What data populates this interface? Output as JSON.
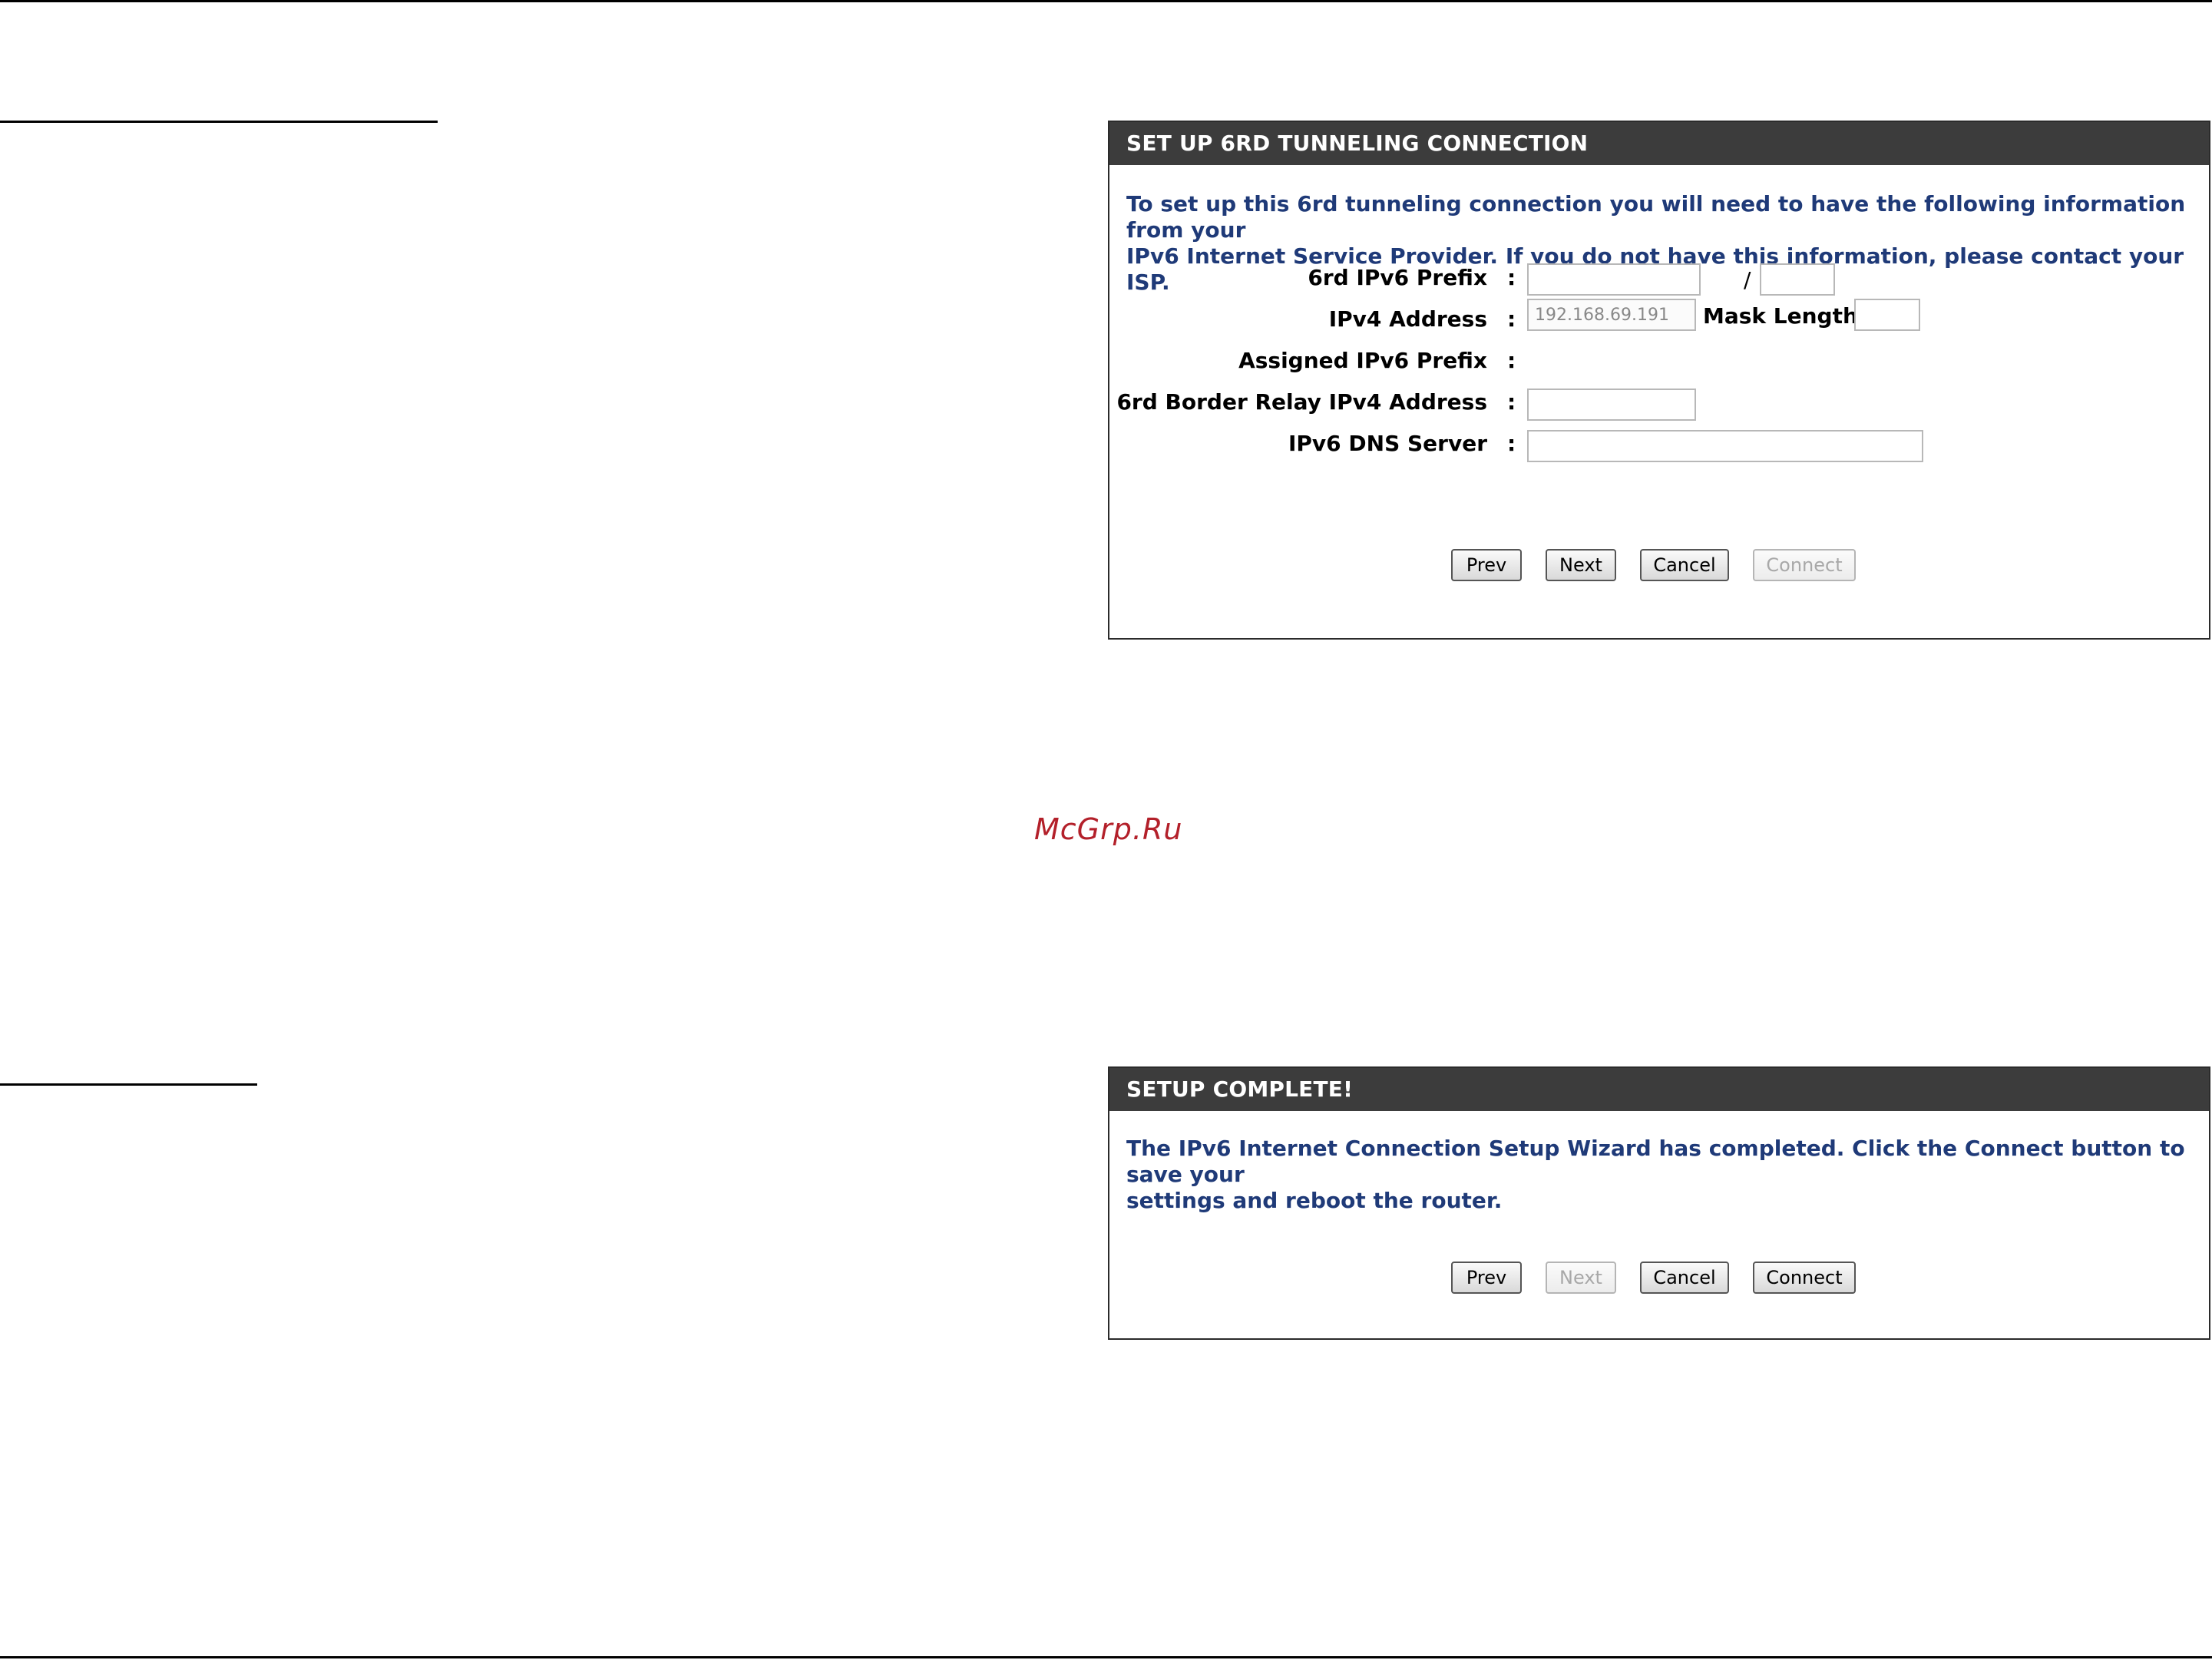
{
  "watermark": "McGrp.Ru",
  "tunnel_panel": {
    "title": "SET UP 6RD TUNNELING CONNECTION",
    "intro_line1": "To set up this 6rd tunneling connection you will need to have the following information from your",
    "intro_line2": "IPv6 Internet Service Provider. If you do not have this information, please contact your ISP.",
    "fields": {
      "prefix_label": "6rd IPv6 Prefix",
      "prefix_value": "",
      "prefix_slash": "/",
      "prefix_length_value": "",
      "ipv4_label": "IPv4 Address",
      "ipv4_value": "192.168.69.191",
      "mask_label": "Mask Length :",
      "mask_value": "",
      "assigned_label": "Assigned IPv6 Prefix",
      "border_relay_label": "6rd Border Relay IPv4 Address",
      "border_relay_value": "",
      "dns_label": "IPv6 DNS Server",
      "dns_value": "",
      "colon": ":"
    },
    "buttons": {
      "prev": "Prev",
      "next": "Next",
      "cancel": "Cancel",
      "connect": "Connect"
    },
    "connect_enabled": false
  },
  "complete_panel": {
    "title": "SETUP COMPLETE!",
    "intro_line1": "The IPv6 Internet Connection Setup Wizard has completed. Click the Connect button to save your",
    "intro_line2": "settings and reboot the router.",
    "buttons": {
      "prev": "Prev",
      "next": "Next",
      "cancel": "Cancel",
      "connect": "Connect"
    },
    "next_enabled": false
  },
  "colors": {
    "header_bg": "#3c3c3c",
    "intro_text": "#1f3a78",
    "watermark": "#b3202a"
  }
}
